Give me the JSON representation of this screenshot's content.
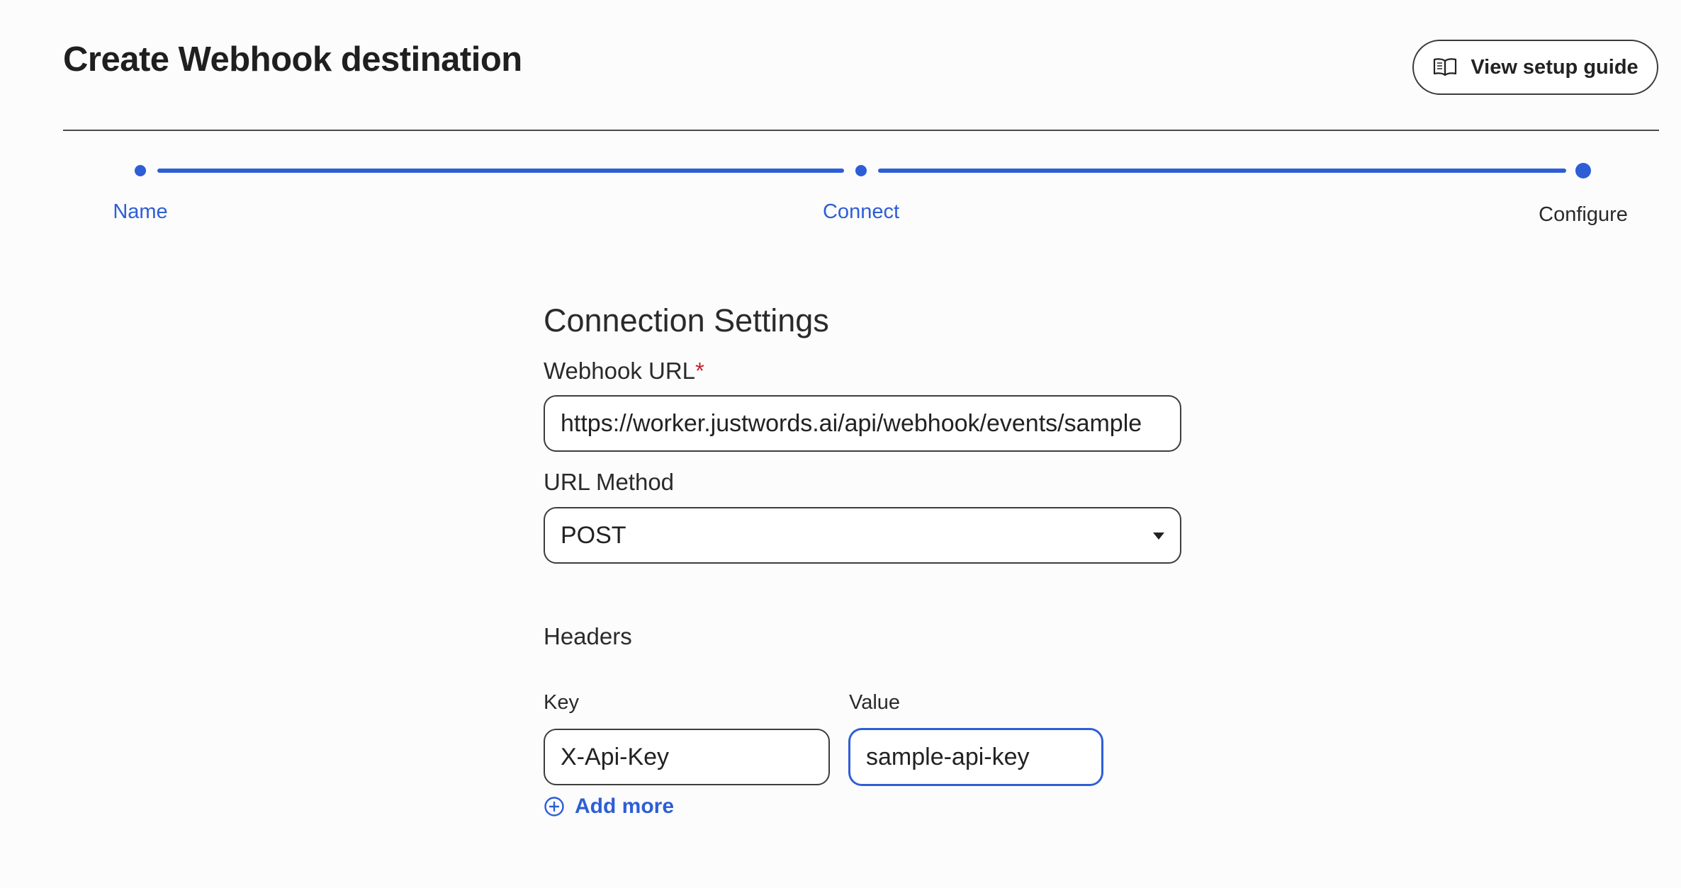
{
  "header": {
    "title": "Create Webhook destination",
    "guide_button_label": "View setup guide",
    "guide_icon": "book-open-icon"
  },
  "stepper": {
    "steps": [
      {
        "label": "Name",
        "state": "complete"
      },
      {
        "label": "Connect",
        "state": "complete"
      },
      {
        "label": "Configure",
        "state": "current"
      }
    ],
    "accent_color": "#2d5ed6"
  },
  "form": {
    "section_title": "Connection Settings",
    "webhook_url": {
      "label": "Webhook URL",
      "required_marker": "*",
      "value": "https://worker.justwords.ai/api/webhook/events/sample"
    },
    "url_method": {
      "label": "URL Method",
      "selected": "POST"
    },
    "headers": {
      "title": "Headers",
      "key_label": "Key",
      "value_label": "Value",
      "rows": [
        {
          "key": "X-Api-Key",
          "value": "sample-api-key"
        }
      ],
      "add_more_label": "Add more",
      "add_more_icon": "plus-circle-icon"
    }
  }
}
